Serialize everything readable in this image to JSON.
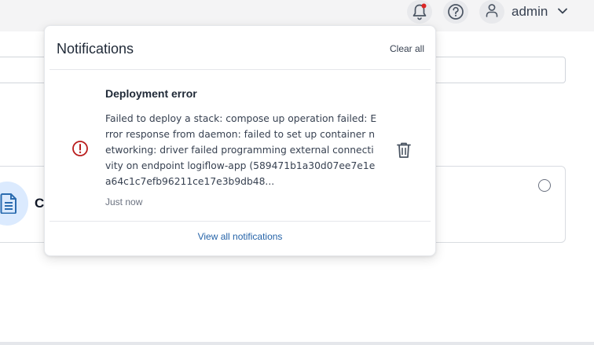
{
  "header": {
    "notifications_icon": "bell-icon",
    "help_icon": "help-circle-icon",
    "user_icon": "user-icon",
    "username": "admin",
    "dropdown_icon": "chevron-down-icon",
    "badge_color": "#dc2626"
  },
  "background": {
    "card_title_visible": "C",
    "card_icon": "document-icon"
  },
  "notifications": {
    "title": "Notifications",
    "clear_all_label": "Clear all",
    "items": [
      {
        "title": "Deployment error",
        "message": "Failed to deploy a stack: compose up operation failed: Error response from daemon: failed to set up container networking: driver failed programming external connectivity on endpoint logiflow-app (589471b1a30d07ee7e1ea64c1c7efb96211ce17e3b9db48...",
        "time": "Just now",
        "status_icon": "error-circle-icon",
        "status_color": "#b91c1c",
        "delete_icon": "trash-icon"
      }
    ],
    "view_all_label": "View all notifications",
    "link_color": "#2563a8"
  }
}
